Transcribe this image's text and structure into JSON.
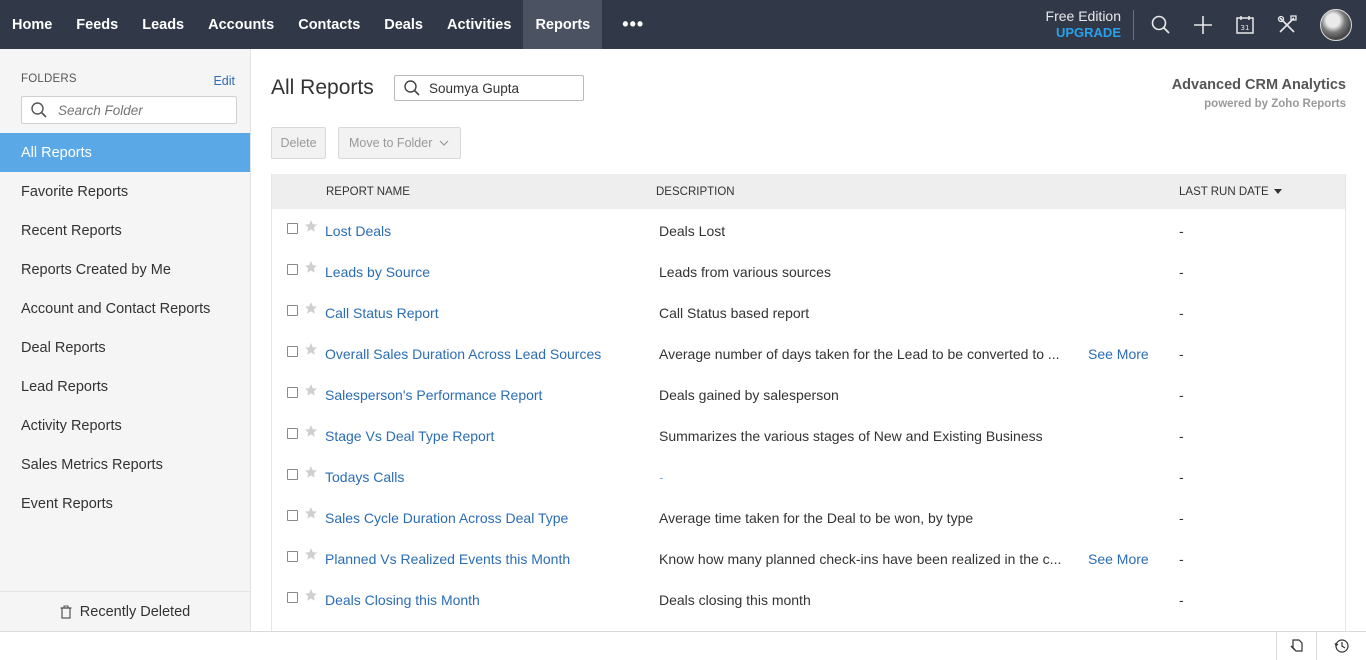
{
  "nav": {
    "items": [
      {
        "label": "Home"
      },
      {
        "label": "Feeds"
      },
      {
        "label": "Leads"
      },
      {
        "label": "Accounts"
      },
      {
        "label": "Contacts"
      },
      {
        "label": "Deals"
      },
      {
        "label": "Activities"
      },
      {
        "label": "Reports",
        "active": true
      }
    ],
    "more_label": "•••",
    "edition_label": "Free Edition",
    "upgrade_label": "UPGRADE",
    "icons": [
      "search-icon",
      "add-icon",
      "calendar-icon",
      "setup-tools-icon",
      "avatar"
    ],
    "calendar_day": "31"
  },
  "sidebar": {
    "folders_heading": "FOLDERS",
    "edit_label": "Edit",
    "search_placeholder": "Search Folder",
    "items": [
      {
        "label": "All Reports",
        "active": true
      },
      {
        "label": "Favorite Reports"
      },
      {
        "label": "Recent Reports"
      },
      {
        "label": "Reports Created by Me"
      },
      {
        "label": "Account and Contact Reports"
      },
      {
        "label": "Deal Reports"
      },
      {
        "label": "Lead Reports"
      },
      {
        "label": "Activity Reports"
      },
      {
        "label": "Sales Metrics Reports"
      },
      {
        "label": "Event Reports"
      }
    ],
    "recently_deleted_label": "Recently Deleted"
  },
  "main": {
    "title": "All Reports",
    "search_value": "Soumya Gupta",
    "analytics_title": "Advanced CRM Analytics",
    "analytics_sub": "powered by Zoho Reports",
    "delete_label": "Delete",
    "move_label": "Move to Folder"
  },
  "table": {
    "columns": {
      "name": "REPORT NAME",
      "description": "DESCRIPTION",
      "last_run": "LAST RUN DATE"
    },
    "rows": [
      {
        "name": "Lost Deals",
        "description": "Deals Lost",
        "more": "",
        "last_run": "-"
      },
      {
        "name": "Leads by Source",
        "description": "Leads from various sources",
        "more": "",
        "last_run": "-"
      },
      {
        "name": "Call Status Report",
        "description": "Call Status based report",
        "more": "",
        "last_run": "-"
      },
      {
        "name": "Overall Sales Duration Across Lead Sources",
        "description": "Average number of days taken for the Lead to be converted to ...",
        "more": "See More",
        "last_run": "-"
      },
      {
        "name": "Salesperson's Performance Report",
        "description": "Deals gained by salesperson",
        "more": "",
        "last_run": "-"
      },
      {
        "name": "Stage Vs Deal Type Report",
        "description": "Summarizes the various stages of New and Existing Business",
        "more": "",
        "last_run": "-"
      },
      {
        "name": "Todays Calls",
        "description": "-",
        "more": "",
        "last_run": "-"
      },
      {
        "name": "Sales Cycle Duration Across Deal Type",
        "description": "Average time taken for the Deal to be won, by type",
        "more": "",
        "last_run": "-"
      },
      {
        "name": "Planned Vs Realized Events this Month",
        "description": "Know how many planned check-ins have been realized in the c...",
        "more": "See More",
        "last_run": "-"
      },
      {
        "name": "Deals Closing this Month",
        "description": "Deals closing this month",
        "more": "",
        "last_run": "-"
      }
    ]
  },
  "colors": {
    "nav_bg": "#313949",
    "nav_active": "#4b5363",
    "accent": "#5aa9e6",
    "link": "#2b6db4",
    "upgrade": "#2aa0ea"
  }
}
